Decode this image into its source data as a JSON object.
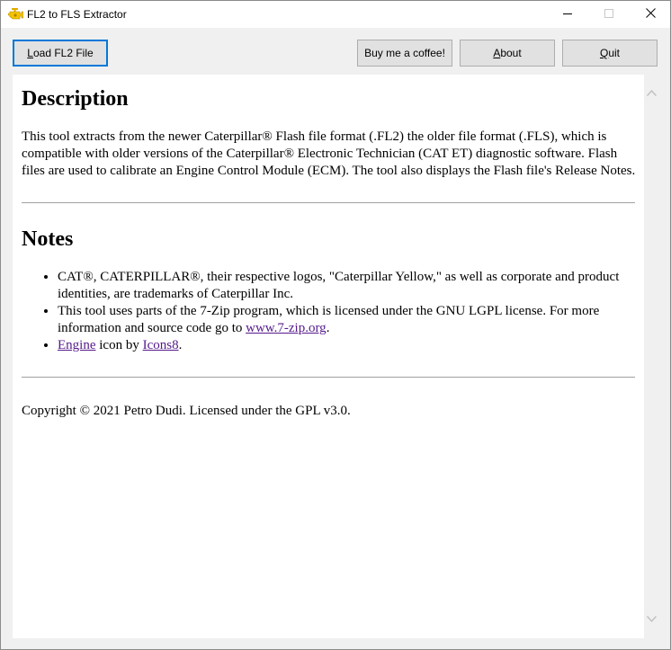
{
  "window": {
    "title": "FL2 to FLS Extractor"
  },
  "toolbar": {
    "load": {
      "hot": "L",
      "rest": "oad FL2 File"
    },
    "coffee": "Buy me a coffee!",
    "about": {
      "hot": "A",
      "rest": "bout"
    },
    "quit": {
      "hot": "Q",
      "rest": "uit"
    }
  },
  "description": {
    "heading": "Description",
    "text": "This tool extracts from the newer Caterpillar® Flash file format (.FL2) the older file format (.FLS), which is compatible with older versions of the Caterpillar® Electronic Technician (CAT ET) diagnostic software. Flash files are used to calibrate an Engine Control Module (ECM). The tool also displays the Flash file's Release Notes."
  },
  "notes": {
    "heading": "Notes",
    "item1": "CAT®, CATERPILLAR®, their respective logos, \"Caterpillar Yellow,\" as well as corporate and product identities, are trademarks of Caterpillar Inc.",
    "item2_text": "This tool uses parts of the 7-Zip program, which is licensed under the GNU LGPL license. For more information and source code go to ",
    "item2_link": "www.7-zip.org",
    "item2_end": ".",
    "item3_link1": "Engine",
    "item3_mid": " icon by ",
    "item3_link2": "Icons8",
    "item3_end": "."
  },
  "copyright": "Copyright © 2021 Petro Dudi. Licensed under the GPL v3.0.",
  "icons": {
    "app": "engine-icon",
    "minimize": "minimize-icon",
    "maximize": "maximize-icon",
    "close": "close-icon",
    "scroll_up": "chevron-up-icon",
    "scroll_down": "chevron-down-icon"
  },
  "colors": {
    "accent": "#0078d7",
    "visited_link": "#551a8b",
    "engine_yellow": "#f5c400"
  }
}
